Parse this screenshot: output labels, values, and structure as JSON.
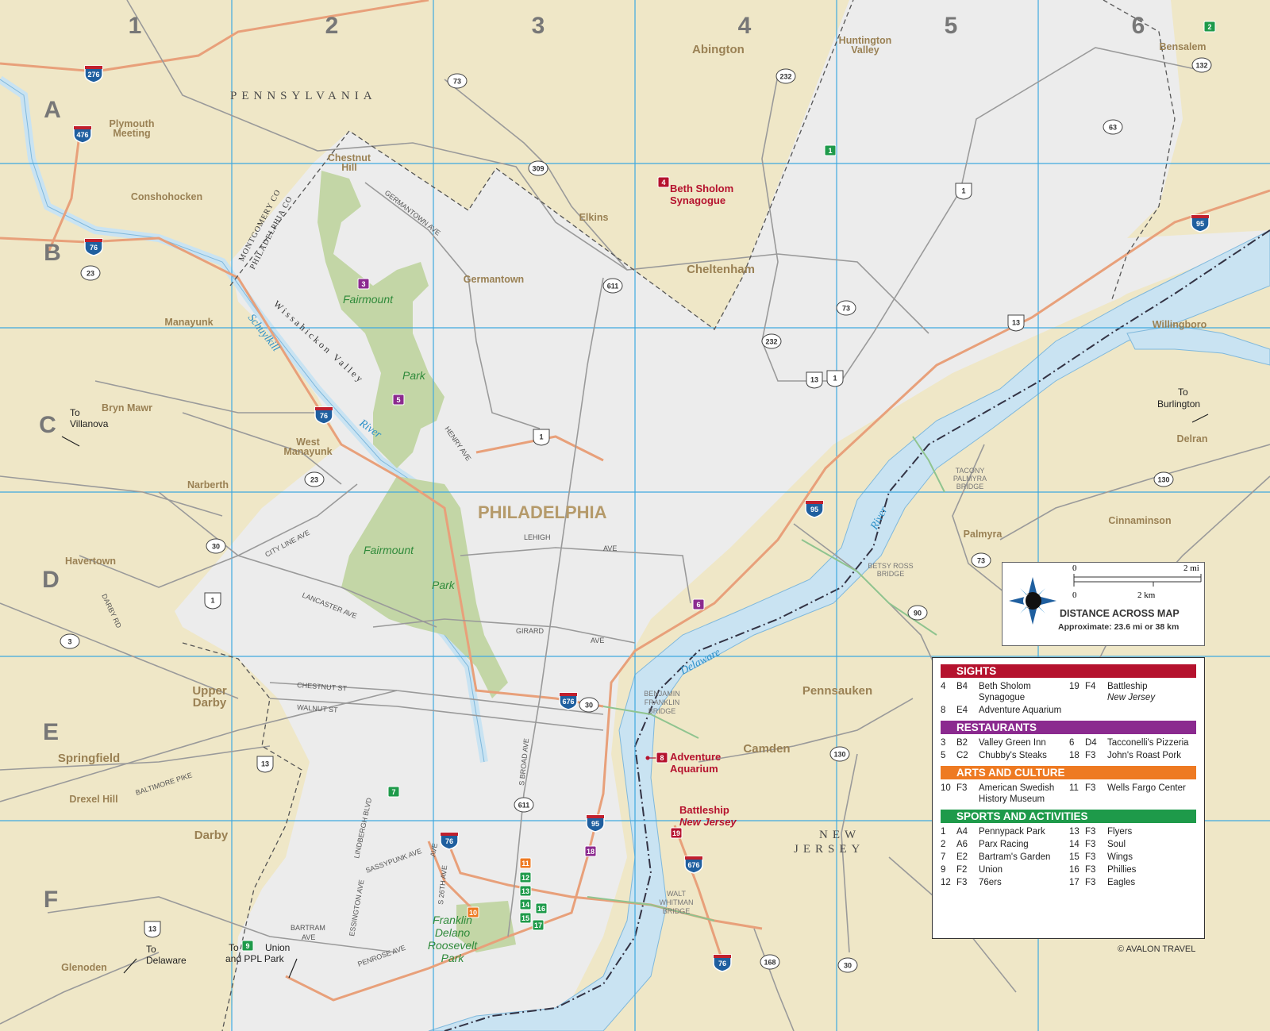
{
  "grid": {
    "columns": [
      "1",
      "2",
      "3",
      "4",
      "5",
      "6"
    ],
    "rows": [
      "A",
      "B",
      "C",
      "D",
      "E",
      "F"
    ]
  },
  "states": {
    "pennsylvania": "PENNSYLVANIA",
    "new": "NEW",
    "jersey": "JERSEY"
  },
  "county_line": {
    "montgomery": "MONTGOMERY CO",
    "philadelphia": "PHILADELPHIA CO"
  },
  "city": "PHILADELPHIA",
  "places": {
    "abington": "Abington",
    "huntington_1": "Huntington",
    "huntington_2": "Valley",
    "bensalem": "Bensalem",
    "plymouth_1": "Plymouth",
    "plymouth_2": "Meeting",
    "chestnut_1": "Chestnut",
    "chestnut_2": "Hill",
    "conshohocken": "Conshohocken",
    "elkins": "Elkins",
    "cheltenham": "Cheltenham",
    "germantown": "Germantown",
    "manayunk": "Manayunk",
    "willingboro": "Willingboro",
    "bryn_mawr": "Bryn Mawr",
    "west_1": "West",
    "west_2": "Manayunk",
    "delran": "Delran",
    "narberth": "Narberth",
    "cinnaminson": "Cinnaminson",
    "palmyra": "Palmyra",
    "havertown": "Havertown",
    "upper_1": "Upper",
    "upper_2": "Darby",
    "pennsauken": "Pennsauken",
    "springfield": "Springfield",
    "camden": "Camden",
    "drexel_hill": "Drexel Hill",
    "darby": "Darby",
    "glenoden": "Glenoden"
  },
  "directions": {
    "villanova_1": "To",
    "villanova_2": "Villanova",
    "burlington_1": "To",
    "burlington_2": "Burlington",
    "delaware_1": "To",
    "delaware_2": "Delaware",
    "union_1": "To",
    "union_2": "Union",
    "union_3": "and PPL Park"
  },
  "water": {
    "schuylkill": "Schuylkill",
    "river1": "River",
    "river2": "River",
    "delaware": "Delaware"
  },
  "parks": {
    "fairmount1": "Fairmount",
    "park1": "Park",
    "fairmount2": "Fairmount",
    "park2": "Park",
    "fdr_1": "Franklin",
    "fdr_2": "Delano",
    "fdr_3": "Roosevelt",
    "fdr_4": "Park",
    "wissahickon": "Wissahickon Valley"
  },
  "streets": {
    "germantown_ave": "GERMANTOWN AVE",
    "henry_ave": "HENRY AVE",
    "lehigh": "LEHIGH",
    "ave1": "AVE",
    "city_line": "CITY LINE AVE",
    "darby_rd": "DARBY RD",
    "lancaster": "LANCASTER AVE",
    "girard": "GIRARD",
    "ave2": "AVE",
    "chestnut": "CHESTNUT ST",
    "walnut": "WALNUT ST",
    "broad": "S BROAD AVE",
    "baltimore": "BALTIMORE PIKE",
    "lindbergh": "LINDBERGH BLVD",
    "sassypunk": "SASSYPUNK AVE",
    "s26": "S 26TH AVE",
    "ave3": "AVE",
    "essington": "ESSINGTON AVE",
    "bartram_1": "BARTRAM",
    "bartram_2": "AVE",
    "penrose": "PENROSE AVE"
  },
  "bridges": {
    "tacony_1": "TACONY",
    "tacony_2": "PALMYRA",
    "tacony_3": "BRIDGE",
    "betsy_1": "BETSY ROSS",
    "betsy_2": "BRIDGE",
    "franklin_1": "BENJAMIN",
    "franklin_2": "FRANKLIN",
    "franklin_3": "BRIDGE",
    "walt_1": "WALT",
    "walt_2": "WHITMAN",
    "walt_3": "BRIDGE"
  },
  "map_sights": {
    "beth_1": "Beth Sholom",
    "beth_2": "Synagogue",
    "aquarium_1": "Adventure",
    "aquarium_2": "Aquarium",
    "battleship_1": "Battleship",
    "battleship_2": "New Jersey"
  },
  "highways": {
    "i276": "276",
    "i476": "476",
    "i76a": "76",
    "i76b": "76",
    "i76c": "76",
    "i76d": "76",
    "i95a": "95",
    "i95b": "95",
    "i95c": "95",
    "i676a": "676",
    "i676b": "676",
    "r73a": "73",
    "r73b": "73",
    "r73c": "73",
    "r232a": "232",
    "r232b": "232",
    "r309": "309",
    "r611a": "611",
    "r611b": "611",
    "r63": "63",
    "r132": "132",
    "r1a": "1",
    "r1b": "1",
    "r1c": "1",
    "r1d": "1",
    "r13a": "13",
    "r13b": "13",
    "r13c": "13",
    "r13d": "13",
    "r23a": "23",
    "r23b": "23",
    "r30a": "30",
    "r30b": "30",
    "r30c": "30",
    "r3": "3",
    "r130a": "130",
    "r130b": "130",
    "r90": "90",
    "r168": "168"
  },
  "pois": {
    "p1": "1",
    "p2": "2",
    "p3": "3",
    "p4": "4",
    "p5": "5",
    "p6": "6",
    "p7": "7",
    "p8": "8",
    "p9": "9",
    "p10": "10",
    "p11": "11",
    "p12": "12",
    "p13": "13",
    "p14": "14",
    "p15": "15",
    "p16": "16",
    "p17": "17",
    "p18": "18",
    "p19": "19"
  },
  "colors": {
    "sights": "#b5122e",
    "restaurants": "#8b2a8f",
    "arts": "#ee7a22",
    "sports": "#1e9a4a",
    "land": "#efe7c7",
    "city_area": "#eeeeee",
    "water": "#c9e3f2",
    "park": "#c3d6a6",
    "grid": "#3fa9e0"
  },
  "scale": {
    "mi_0": "0",
    "mi_2": "2 mi",
    "km_0": "0",
    "km_2": "2 km",
    "title": "DISTANCE ACROSS MAP",
    "subtitle": "Approximate: 23.6 mi or 38 km"
  },
  "legend": {
    "sights": {
      "title": "SIGHTS",
      "items": [
        {
          "num": "4",
          "grid": "B4",
          "name": "Beth Sholom Synagogue"
        },
        {
          "num": "19",
          "grid": "F4",
          "name": "Battleship",
          "name2": "New Jersey"
        },
        {
          "num": "8",
          "grid": "E4",
          "name": "Adventure Aquarium"
        }
      ]
    },
    "restaurants": {
      "title": "RESTAURANTS",
      "items": [
        {
          "num": "3",
          "grid": "B2",
          "name": "Valley Green Inn"
        },
        {
          "num": "6",
          "grid": "D4",
          "name": "Tacconelli's Pizzeria"
        },
        {
          "num": "5",
          "grid": "C2",
          "name": "Chubby's Steaks"
        },
        {
          "num": "18",
          "grid": "F3",
          "name": "John's Roast Pork"
        }
      ]
    },
    "arts": {
      "title": "ARTS AND CULTURE",
      "items": [
        {
          "num": "10",
          "grid": "F3",
          "name": "American Swedish History Museum"
        },
        {
          "num": "11",
          "grid": "F3",
          "name": "Wells Fargo Center"
        }
      ]
    },
    "sports": {
      "title": "SPORTS AND ACTIVITIES",
      "items": [
        {
          "num": "1",
          "grid": "A4",
          "name": "Pennypack Park"
        },
        {
          "num": "13",
          "grid": "F3",
          "name": "Flyers"
        },
        {
          "num": "2",
          "grid": "A6",
          "name": "Parx Racing"
        },
        {
          "num": "14",
          "grid": "F3",
          "name": "Soul"
        },
        {
          "num": "7",
          "grid": "E2",
          "name": "Bartram's Garden"
        },
        {
          "num": "15",
          "grid": "F3",
          "name": "Wings"
        },
        {
          "num": "9",
          "grid": "F2",
          "name": "Union"
        },
        {
          "num": "16",
          "grid": "F3",
          "name": "Phillies"
        },
        {
          "num": "12",
          "grid": "F3",
          "name": "76ers"
        },
        {
          "num": "17",
          "grid": "F3",
          "name": "Eagles"
        }
      ]
    }
  },
  "credit": "© AVALON TRAVEL"
}
